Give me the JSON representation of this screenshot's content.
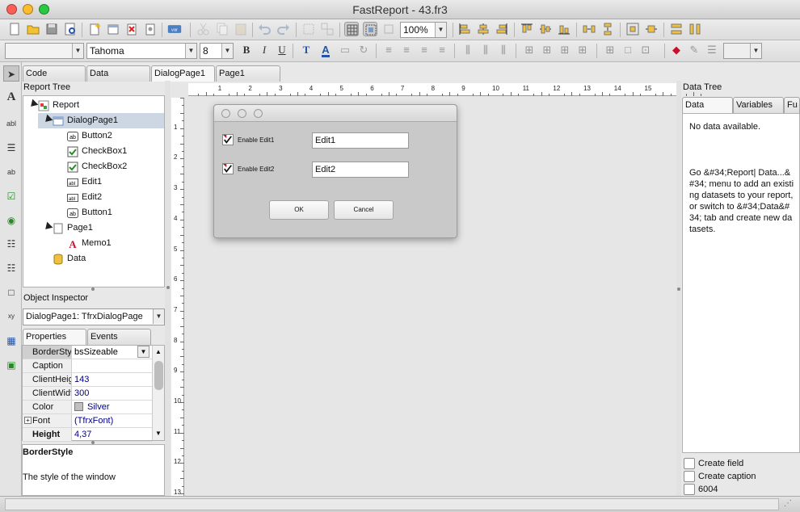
{
  "window": {
    "title": "FastReport - 43.fr3"
  },
  "toolbar2": {
    "font_name": "Tahoma",
    "font_size": "8",
    "zoom": "100%",
    "style_combo": ""
  },
  "tabs": [
    {
      "label": "Code"
    },
    {
      "label": "Data"
    },
    {
      "label": "DialogPage1"
    },
    {
      "label": "Page1"
    }
  ],
  "report_tree": {
    "header": "Report Tree",
    "items": [
      {
        "label": "Report"
      },
      {
        "label": "DialogPage1"
      },
      {
        "label": "Button2"
      },
      {
        "label": "CheckBox1"
      },
      {
        "label": "CheckBox2"
      },
      {
        "label": "Edit1"
      },
      {
        "label": "Edit2"
      },
      {
        "label": "Button1"
      },
      {
        "label": "Page1"
      },
      {
        "label": "Memo1"
      },
      {
        "label": "Data"
      }
    ]
  },
  "object_inspector": {
    "header": "Object Inspector",
    "selected": "DialogPage1: TfrxDialogPage",
    "tabs": [
      "Properties",
      "Events"
    ],
    "properties": [
      {
        "name": "BorderStyle",
        "value": "bsSizeable"
      },
      {
        "name": "Caption",
        "value": ""
      },
      {
        "name": "ClientHeight",
        "value": "143"
      },
      {
        "name": "ClientWidth",
        "value": "300"
      },
      {
        "name": "Color",
        "value": "Silver"
      },
      {
        "name": "Font",
        "value": "(TfrxFont)"
      },
      {
        "name": "Height",
        "value": "4,37"
      }
    ],
    "help_title": "BorderStyle",
    "help_text": "The style of the window"
  },
  "ruler": {
    "marks": [
      "1",
      "2",
      "3",
      "4",
      "5",
      "6",
      "7",
      "8",
      "9",
      "10",
      "11",
      "12",
      "13",
      "14",
      "15"
    ],
    "vmarks": [
      "1",
      "2",
      "3",
      "4",
      "5",
      "6",
      "7",
      "8",
      "9",
      "10",
      "11",
      "12",
      "13"
    ]
  },
  "dialog": {
    "checkbox1_label": "Enable Edit1",
    "checkbox2_label": "Enable Edit2",
    "edit1_value": "Edit1",
    "edit2_value": "Edit2",
    "ok_label": "OK",
    "cancel_label": "Cancel"
  },
  "data_tree": {
    "header": "Data Tree",
    "tabs": [
      "Data",
      "Variables",
      "Fu"
    ],
    "empty": "No data available.",
    "hint": "Go &#34;Report| Data...&#34; menu to add an existing datasets to your report, or switch to &#34;Data&#34; tab and create new datasets.",
    "options": [
      {
        "label": "Create field"
      },
      {
        "label": "Create caption"
      },
      {
        "label": "6004"
      }
    ]
  },
  "colors": {
    "accent_red": "#c8102e",
    "selected_row": "#cdd7e4",
    "canvas": "#e6e6e6"
  }
}
